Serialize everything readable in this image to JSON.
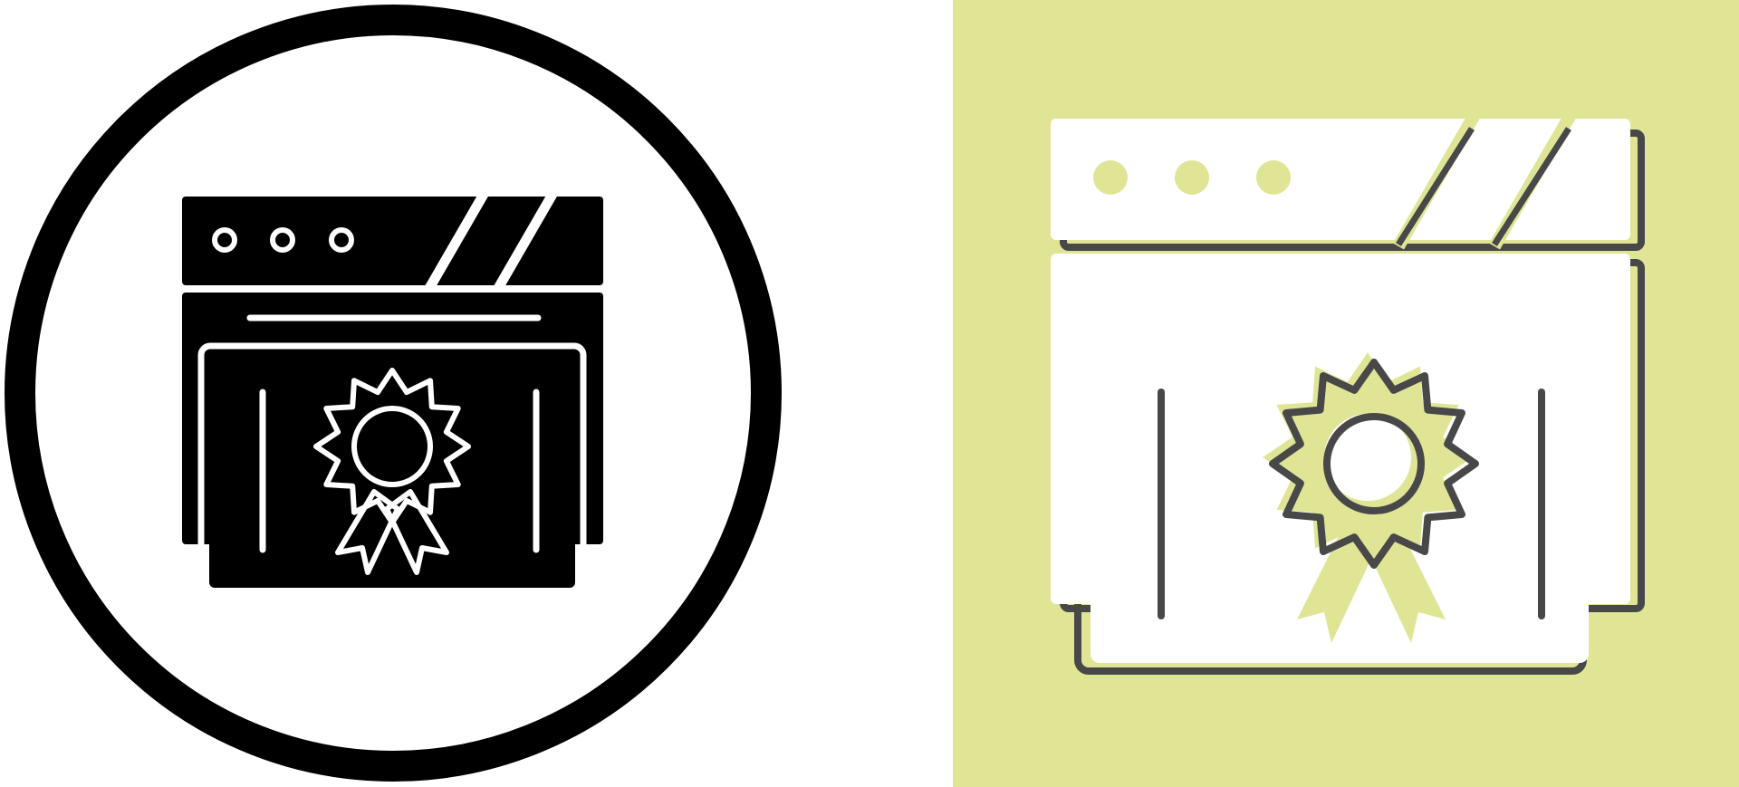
{
  "colors": {
    "page_background": "#ffffff",
    "ink": "#000000",
    "right_background": "#e0e596",
    "shadow": "#484848",
    "highlight": "#ffffff",
    "accent_fill": "#e0e596"
  },
  "icons": [
    {
      "name": "website-certificate-glyph-icon",
      "style": "solid glyph inside circle"
    },
    {
      "name": "website-certificate-flat-icon",
      "style": "flat with offset shadow"
    }
  ]
}
